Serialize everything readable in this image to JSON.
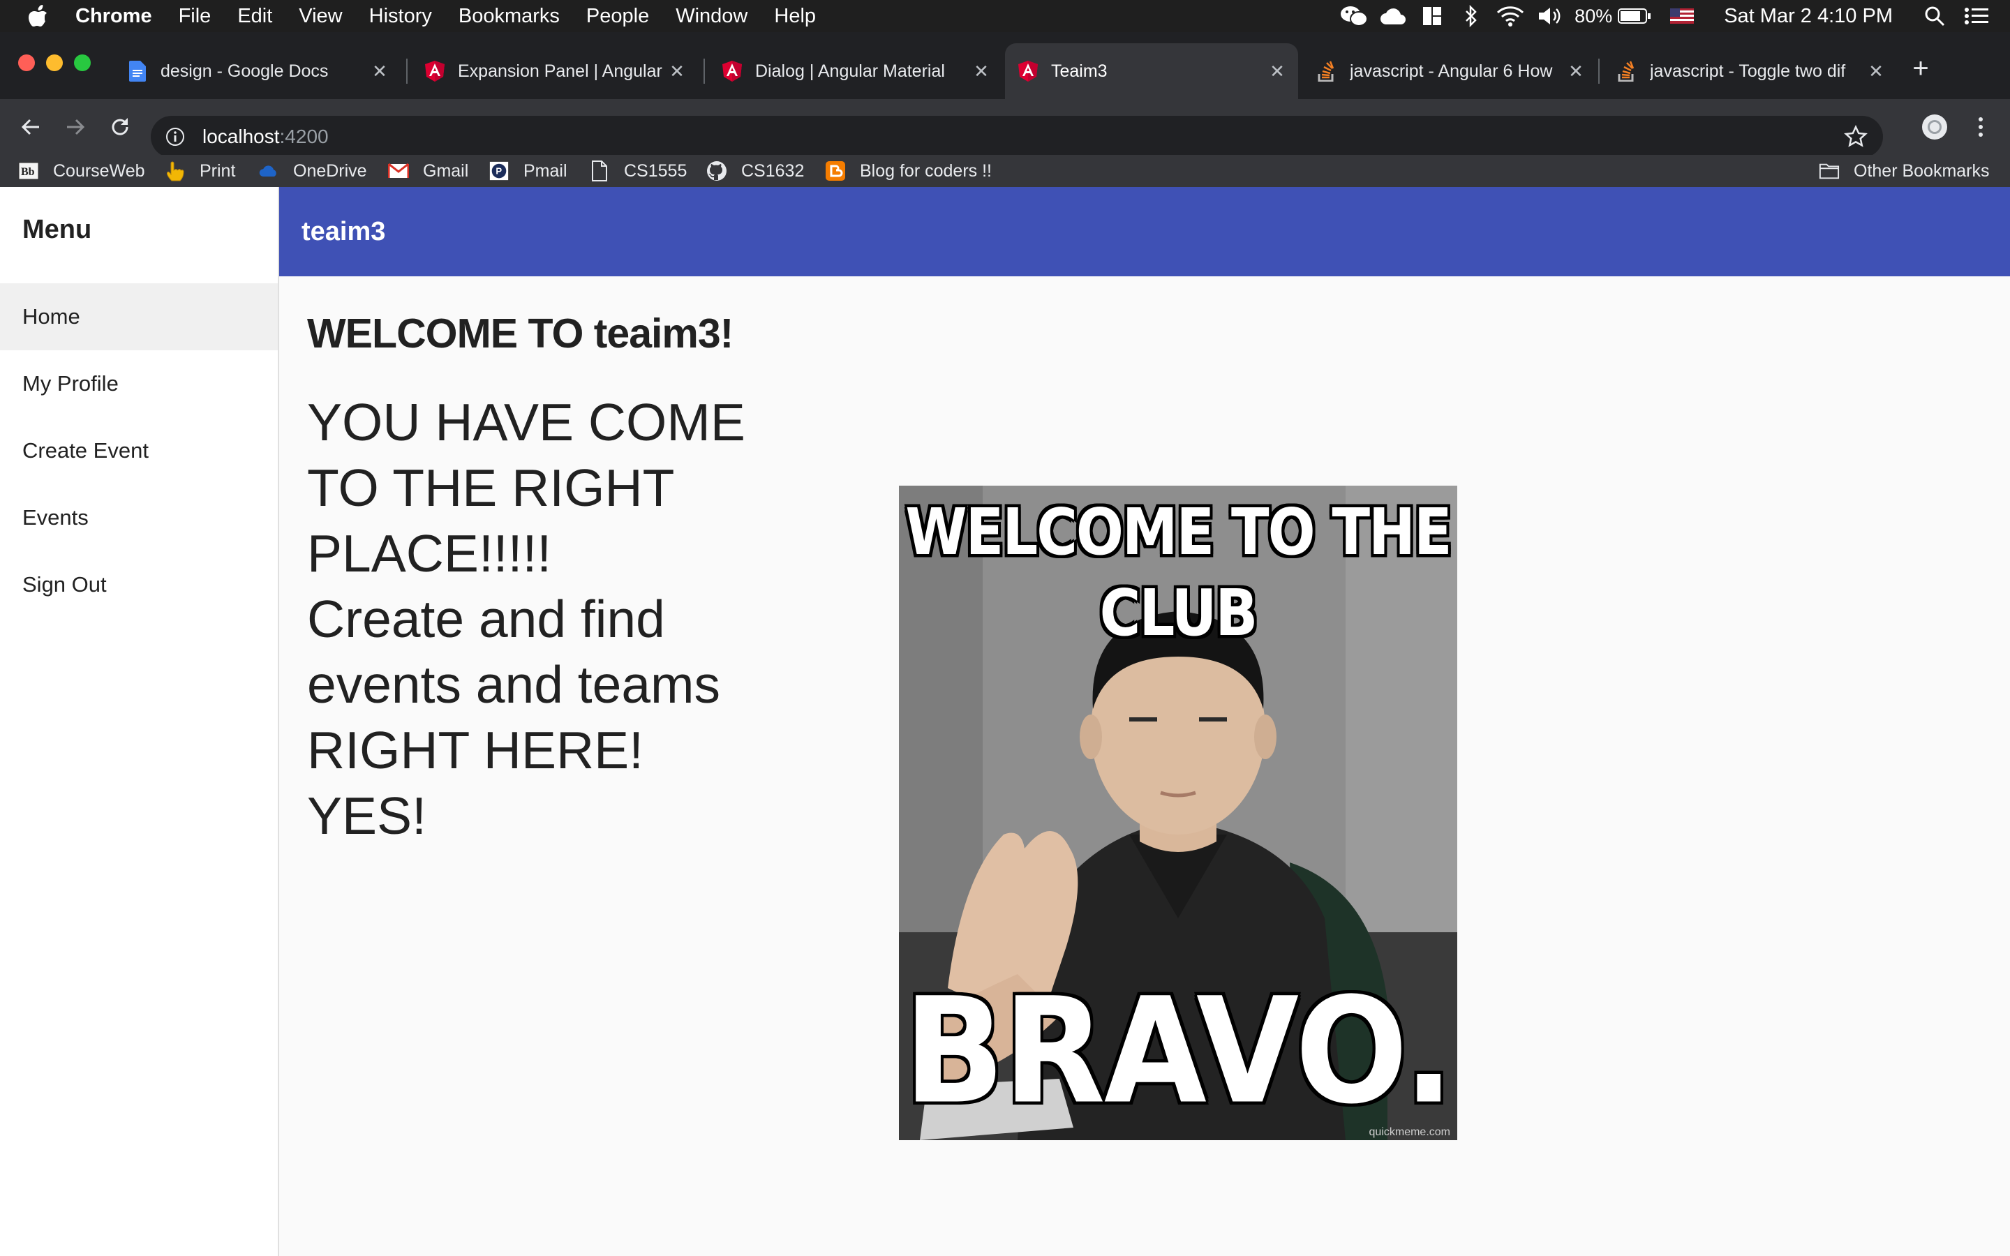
{
  "menubar": {
    "app_name": "Chrome",
    "items": [
      "File",
      "Edit",
      "View",
      "History",
      "Bookmarks",
      "People",
      "Window",
      "Help"
    ],
    "battery": "80%",
    "clock": "Sat Mar 2  4:10 PM",
    "status_icons": [
      "wechat-icon",
      "cloud-icon",
      "layout-icon",
      "bluetooth-icon",
      "wifi-icon",
      "volume-icon",
      "battery-icon",
      "flag-us-icon",
      "spotlight-search-icon",
      "notification-list-icon"
    ]
  },
  "browser": {
    "tabs": [
      {
        "title": "design - Google Docs",
        "icon": "google-docs-icon",
        "active": false
      },
      {
        "title": "Expansion Panel | Angular",
        "icon": "angular-icon",
        "active": false
      },
      {
        "title": "Dialog | Angular Material",
        "icon": "angular-icon",
        "active": false
      },
      {
        "title": "Teaim3",
        "icon": "angular-icon",
        "active": true
      },
      {
        "title": "javascript - Angular 6 How",
        "icon": "stackoverflow-icon",
        "active": false
      },
      {
        "title": "javascript - Toggle two dif",
        "icon": "stackoverflow-icon",
        "active": false
      }
    ],
    "url_host": "localhost",
    "url_port": ":4200",
    "bookmarks": [
      {
        "label": "CourseWeb",
        "icon": "blackboard-icon"
      },
      {
        "label": "Print",
        "icon": "hand-pointer-icon"
      },
      {
        "label": "OneDrive",
        "icon": "onedrive-cloud-icon"
      },
      {
        "label": "Gmail",
        "icon": "gmail-icon"
      },
      {
        "label": "Pmail",
        "icon": "pmail-icon"
      },
      {
        "label": "CS1555",
        "icon": "page-icon"
      },
      {
        "label": "CS1632",
        "icon": "github-icon"
      },
      {
        "label": "Blog for coders !!",
        "icon": "blogger-icon"
      }
    ],
    "other_bookmarks": "Other Bookmarks"
  },
  "app": {
    "sidenav_title": "Menu",
    "nav_items": [
      "Home",
      "My Profile",
      "Create Event",
      "Events",
      "Sign Out"
    ],
    "active_nav": "Home",
    "toolbar_title": "teaim3",
    "welcome_heading": "WELCOME TO teaim3!",
    "tagline_lines": [
      "YOU HAVE COME",
      "TO THE RIGHT",
      "PLACE!!!!!",
      "Create and find",
      "events and teams",
      "RIGHT HERE!",
      "YES!"
    ],
    "meme": {
      "top_line_1": "WELCOME TO THE",
      "top_line_2": "CLUB",
      "bottom_text": "BRAVO.",
      "watermark": "quickmeme.com"
    }
  },
  "colors": {
    "app_toolbar": "#3f51b5",
    "browser_chrome": "#35363a",
    "menubar": "#1f1f1f"
  }
}
